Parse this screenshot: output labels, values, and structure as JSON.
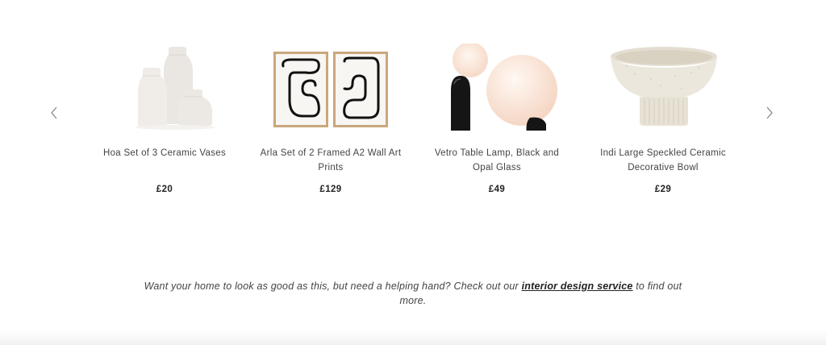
{
  "carousel": {
    "prev_icon": "chevron-left-icon",
    "next_icon": "chevron-right-icon",
    "products": [
      {
        "name": "Hoa Set of 3 Ceramic Vases",
        "price": "£20",
        "image": "ceramic-vases-image"
      },
      {
        "name": "Arla Set of 2 Framed A2 Wall Art Prints",
        "price": "£129",
        "image": "framed-prints-image"
      },
      {
        "name": "Vetro Table Lamp, Black and Opal Glass",
        "price": "£49",
        "image": "table-lamp-image"
      },
      {
        "name": "Indi Large Speckled Ceramic Decorative Bowl",
        "price": "£29",
        "image": "ceramic-bowl-image"
      }
    ]
  },
  "promo": {
    "before": "Want your home to look as good as this, but need a helping hand? Check out our ",
    "link": "interior design service",
    "after": " to find out more."
  },
  "colors": {
    "background": "#ffffff",
    "text": "#444444",
    "price": "#222222",
    "arrow": "#888888"
  }
}
